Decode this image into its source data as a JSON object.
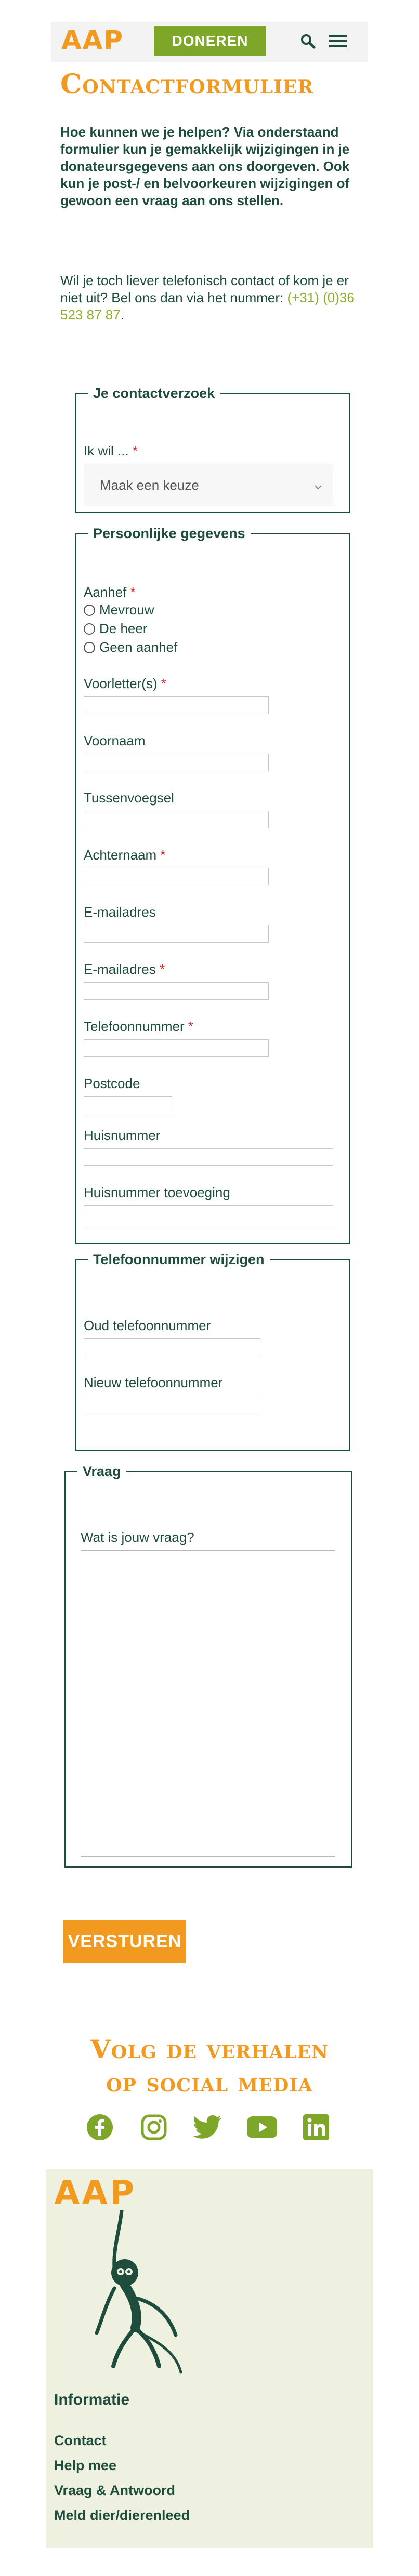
{
  "header": {
    "logo": "AAP",
    "donate_label": "DONEREN"
  },
  "page": {
    "title": "Contactformulier",
    "intro": "Hoe kunnen we je helpen? Via onderstaand formulier kun je gemakkelijk wijzigingen in je donateursgegevens aan ons doorgeven. Ook kun je post-/ en belvoorkeuren wijzigingen of gewoon een vraag aan ons stellen.",
    "intro2_text": "Wil je toch liever telefonisch contact of kom je er niet uit? Bel ons dan via het nummer: ",
    "phone": "(+31) (0)36 523 87 87",
    "intro2_end": "."
  },
  "form": {
    "section_request": {
      "legend": "Je contactverzoek",
      "want_label": "Ik wil ...",
      "select_value": "Maak een keuze"
    },
    "section_personal": {
      "legend": "Persoonlijke gegevens",
      "salutation_label": "Aanhef",
      "options": [
        "Mevrouw",
        "De heer",
        "Geen aanhef"
      ],
      "initials_label": "Voorletter(s)",
      "firstname_label": "Voornaam",
      "infix_label": "Tussenvoegsel",
      "lastname_label": "Achternaam",
      "email_label": "E-mailadres",
      "email2_label": "E-mailadres",
      "phone_label": "Telefoonnummer",
      "postcode_label": "Postcode",
      "housenumber_label": "Huisnummer",
      "housenumber_add_label": "Huisnummer toevoeging"
    },
    "section_phone": {
      "legend": "Telefoonnummer wijzigen",
      "old_label": "Oud telefoonnummer",
      "new_label": "Nieuw telefoonnummer"
    },
    "section_question": {
      "legend": "Vraag",
      "question_label": "Wat is jouw vraag?"
    },
    "required_mark": "*",
    "submit_label": "VERSTUREN"
  },
  "social": {
    "title_line1": "Volg de verhalen",
    "title_line2": "op social media",
    "icons": [
      "facebook-icon",
      "instagram-icon",
      "twitter-icon",
      "youtube-icon",
      "linkedin-icon"
    ]
  },
  "footer": {
    "logo": "AAP",
    "heading": "Informatie",
    "links": [
      "Contact",
      "Help mee",
      "Vraag & Antwoord",
      "Meld dier/dierenleed"
    ]
  },
  "colors": {
    "brand_orange": "#f29a1f",
    "brand_green": "#7ea72a",
    "dark_green": "#1f4d3d",
    "footer_bg": "#eef0e0"
  }
}
